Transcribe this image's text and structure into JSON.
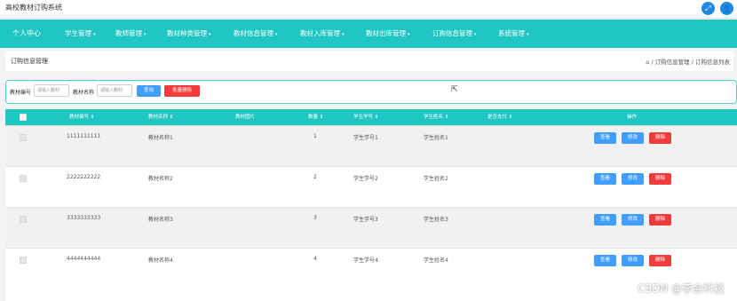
{
  "app": {
    "title": "高校教材订购系统"
  },
  "topbar": {
    "fullscreen_icon": "expand-icon",
    "user_icon": "user-icon"
  },
  "nav": {
    "items": [
      {
        "label": "个人中心"
      },
      {
        "label": "学生管理"
      },
      {
        "label": "教师管理"
      },
      {
        "label": "教材种类管理"
      },
      {
        "label": "教材信息管理"
      },
      {
        "label": "教材入库管理"
      },
      {
        "label": "教材出库管理"
      },
      {
        "label": "订购信息管理"
      },
      {
        "label": "系统管理"
      }
    ],
    "caret": "▾"
  },
  "page": {
    "title": "订购信息管理",
    "breadcrumb": "⌂ / 订购信息管理 / 订购信息列表"
  },
  "search": {
    "field1_label": "教材编号",
    "field1_placeholder": "请输入教材",
    "field2_label": "教材名称",
    "field2_placeholder": "请输入教材",
    "query_label": "查询",
    "batch_delete_label": "批量删除"
  },
  "table": {
    "headers": [
      "教材编号 ⇕",
      "教材名称 ⇕",
      "教材图片",
      "数量 ⇕",
      "学生学号 ⇕",
      "学生姓名 ⇕",
      "是否支付 ⇕",
      "操作"
    ],
    "rows": [
      {
        "code": "1111111111",
        "name": "教材名称1",
        "qty": "1",
        "sid": "学生学号1",
        "sname": "学生姓名1"
      },
      {
        "code": "2222222222",
        "name": "教材名称2",
        "qty": "2",
        "sid": "学生学号2",
        "sname": "学生姓名2"
      },
      {
        "code": "3333333333",
        "name": "教材名称3",
        "qty": "3",
        "sid": "学生学号3",
        "sname": "学生姓名3"
      },
      {
        "code": "4444444444",
        "name": "教材名称4",
        "qty": "4",
        "sid": "学生学号4",
        "sname": "学生姓名4"
      }
    ],
    "actions": {
      "view": "查看",
      "edit": "修改",
      "delete": "删除"
    }
  },
  "watermark": "CSDN @李会科技",
  "colors": {
    "primary": "#1fc6c2",
    "blue": "#409eff",
    "red": "#f23c3c"
  }
}
